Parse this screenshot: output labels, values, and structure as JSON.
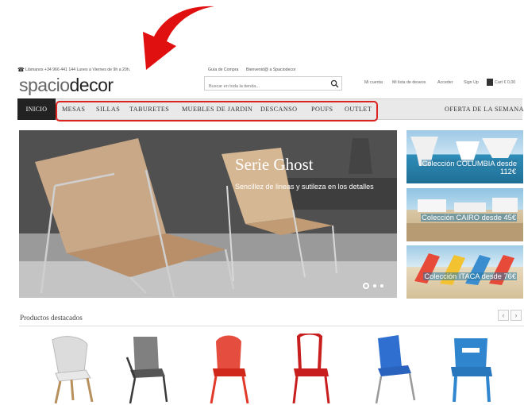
{
  "annotation": {
    "arrow_color": "#e01010"
  },
  "topbar": {
    "phone": "Llámanos +34 966 441 144 Lunes a Viernes de 9h a 20h.",
    "guide": "Guía de Compra",
    "welcome": "Bienvenid@ a Spaciodecor"
  },
  "header": {
    "logo_part1": "spacio",
    "logo_part2": "decor",
    "search_placeholder": "Buscar en toda la tienda...",
    "links": [
      "Mi cuenta",
      "Mi lista de deseos",
      "Acceder",
      "Sign Up"
    ],
    "cart": "Cart € 0,00"
  },
  "nav": {
    "home": "INICIO",
    "items": [
      "MESAS",
      "SILLAS",
      "TABURETES",
      "MUEBLES DE JARDIN",
      "DESCANSO",
      "POUFS",
      "OUTLET"
    ],
    "offer": "OFERTA DE LA SEMANA"
  },
  "hero": {
    "title": "Serie Ghost",
    "subtitle": "Sencillez de lineas y sutileza en los detalles",
    "active_slide": 1,
    "slide_count": 3
  },
  "promos": [
    {
      "label": "Colección COLUMBIA desde 112€"
    },
    {
      "label": "Colección CAIRO desde 45€"
    },
    {
      "label": "Colección ITACA desde 76€"
    }
  ],
  "products": {
    "title": "Productos destacados",
    "prev": "‹",
    "next": "›",
    "items": [
      {
        "color": "#d8d8d8",
        "leg": "#b89060"
      },
      {
        "color": "#5a5a5a",
        "leg": "#333333"
      },
      {
        "color": "#e23a2a",
        "leg": "#e23a2a"
      },
      {
        "color": "#c81e1e",
        "leg": "#c81e1e"
      },
      {
        "color": "#2e6fd0",
        "leg": "#999999"
      },
      {
        "color": "#2f86cf",
        "leg": "#2f86cf"
      }
    ]
  }
}
